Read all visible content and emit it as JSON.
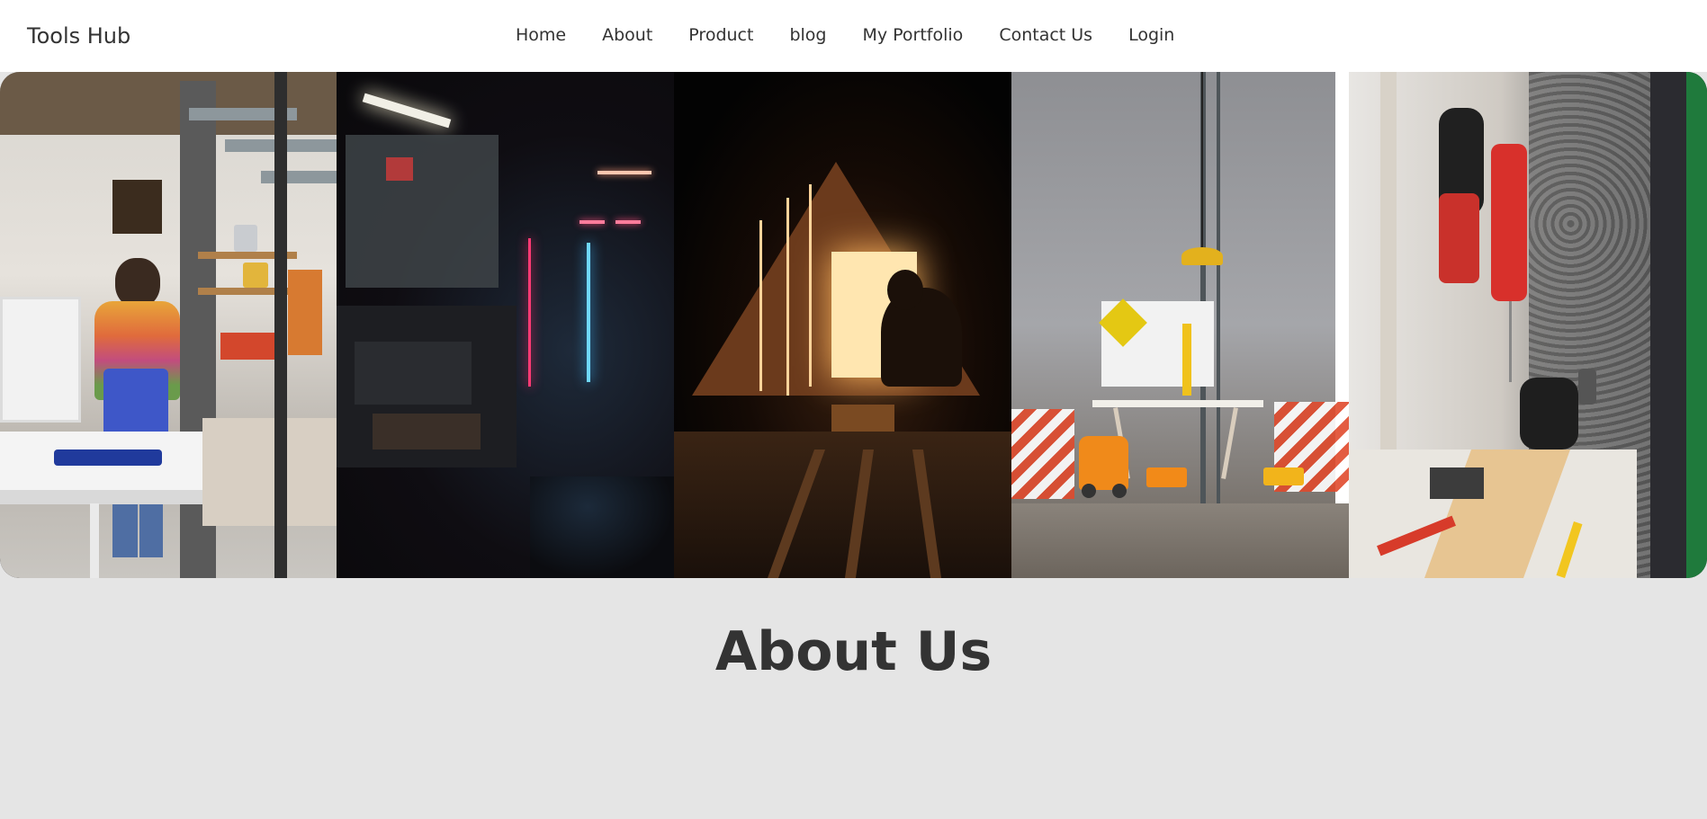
{
  "brand": {
    "name": "Tools Hub"
  },
  "nav": {
    "items": [
      {
        "label": "Home"
      },
      {
        "label": "About"
      },
      {
        "label": "Product"
      },
      {
        "label": "blog"
      },
      {
        "label": "My Portfolio"
      },
      {
        "label": "Contact Us"
      },
      {
        "label": "Login"
      }
    ]
  },
  "gallery": {
    "images": [
      {
        "icon": "art-studio-photo"
      },
      {
        "icon": "workshop-neon-photo"
      },
      {
        "icon": "attic-woodworker-photo"
      },
      {
        "icon": "toy-tools-room-photo"
      },
      {
        "icon": "power-drill-photo"
      }
    ]
  },
  "about": {
    "title": "About Us"
  },
  "colors": {
    "navbar_bg": "#ffffff",
    "page_bg": "#e5e5e5",
    "text": "#333333",
    "accent_green": "#1f7a3c"
  }
}
